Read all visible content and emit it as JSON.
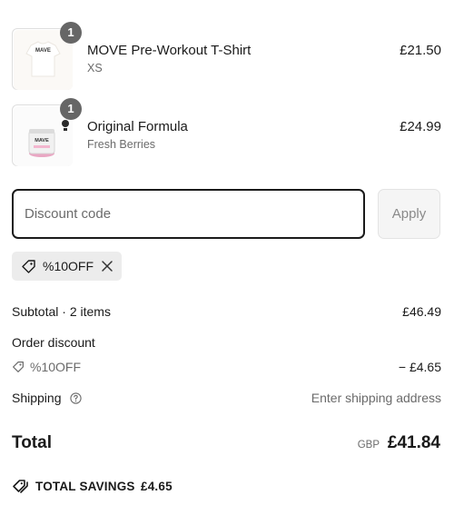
{
  "line_items": [
    {
      "quantity": "1",
      "title": "MOVE Pre-Workout T-Shirt",
      "variant": "XS",
      "price": "£21.50",
      "image": "tshirt-image",
      "image_text": "MAVE"
    },
    {
      "quantity": "1",
      "title": "Original Formula",
      "variant": "Fresh Berries",
      "price": "£24.99",
      "image": "tub-image",
      "image_text": "MAVE"
    }
  ],
  "discount": {
    "placeholder": "Discount code",
    "apply_label": "Apply",
    "applied_code": "%10OFF"
  },
  "summary": {
    "subtotal_label": "Subtotal · 2 items",
    "subtotal_value": "£46.49",
    "order_discount_label": "Order discount",
    "order_discount_code": "%10OFF",
    "order_discount_value": "− £4.65",
    "shipping_label": "Shipping",
    "shipping_value": "Enter shipping address"
  },
  "total": {
    "label": "Total",
    "currency": "GBP",
    "amount": "£41.84"
  },
  "savings": {
    "label": "TOTAL SAVINGS",
    "amount": "£4.65"
  },
  "colors": {
    "badge": "#666666",
    "input_border": "#1a1a1a",
    "muted_text": "#6b6b6b",
    "chip_bg": "#ececec"
  }
}
